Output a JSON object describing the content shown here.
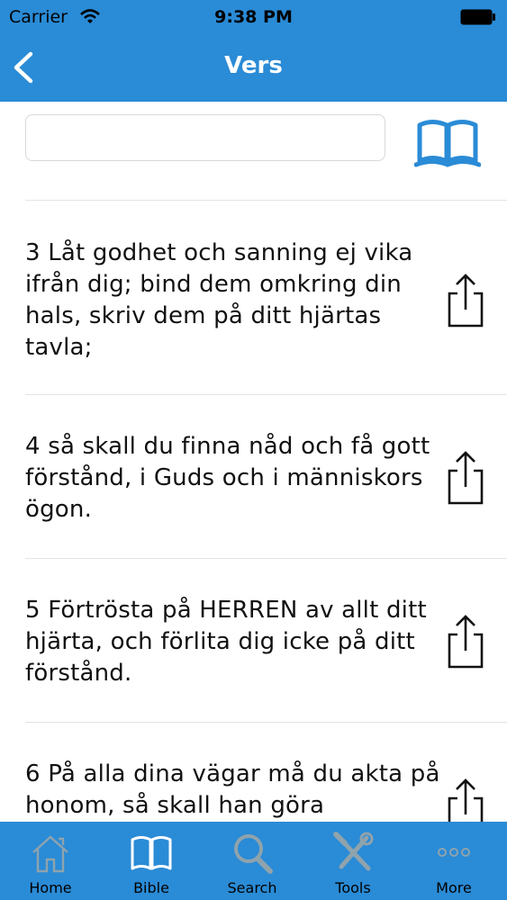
{
  "status": {
    "carrier": "Carrier",
    "time": "9:38 PM"
  },
  "nav": {
    "title": "Vers"
  },
  "search": {
    "value": "",
    "placeholder": ""
  },
  "verses": [
    {
      "text": "3  Låt godhet och sanning ej vika ifrån dig; bind dem omkring din hals, skriv dem på ditt hjärtas tavla;"
    },
    {
      "text": "4  så skall du finna nåd och få gott förstånd, i Guds och i människors ögon."
    },
    {
      "text": "5  Förtrösta på HERREN av allt ditt hjärta, och förlita dig icke på ditt förstånd."
    },
    {
      "text": "6  På alla dina vägar må du akta på honom, så skall han göra"
    }
  ],
  "tabs": [
    {
      "label": "Home",
      "icon": "home-icon"
    },
    {
      "label": "Bible",
      "icon": "book-icon"
    },
    {
      "label": "Search",
      "icon": "magnifier-icon"
    },
    {
      "label": "Tools",
      "icon": "tools-icon"
    },
    {
      "label": "More",
      "icon": "more-icon"
    }
  ],
  "colors": {
    "bar": "#2a8bd6",
    "icon_blue": "#2a8bd6",
    "tab_icon": "#8fa3ad"
  }
}
